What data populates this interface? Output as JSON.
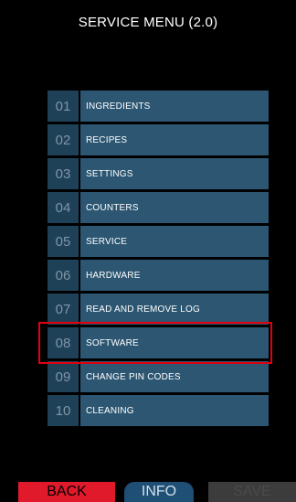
{
  "header": {
    "title": "SERVICE MENU (2.0)"
  },
  "menu": {
    "items": [
      {
        "num": "01",
        "label": "INGREDIENTS"
      },
      {
        "num": "02",
        "label": "RECIPES"
      },
      {
        "num": "03",
        "label": "SETTINGS"
      },
      {
        "num": "04",
        "label": "COUNTERS"
      },
      {
        "num": "05",
        "label": "SERVICE"
      },
      {
        "num": "06",
        "label": "HARDWARE"
      },
      {
        "num": "07",
        "label": "READ AND REMOVE LOG"
      },
      {
        "num": "08",
        "label": "SOFTWARE"
      },
      {
        "num": "09",
        "label": "CHANGE PIN CODES"
      },
      {
        "num": "10",
        "label": "CLEANING"
      }
    ]
  },
  "footer": {
    "back_label": "BACK",
    "info_label": "INFO",
    "save_label": "SAVE"
  },
  "colors": {
    "background": "#000000",
    "item_number_bg": "#1f4158",
    "item_label_bg": "#2c5672",
    "highlight_border": "#e1000f",
    "back_button": "#e11a2b",
    "info_button": "#1f4f75",
    "save_button_disabled": "#3c3c3c"
  }
}
